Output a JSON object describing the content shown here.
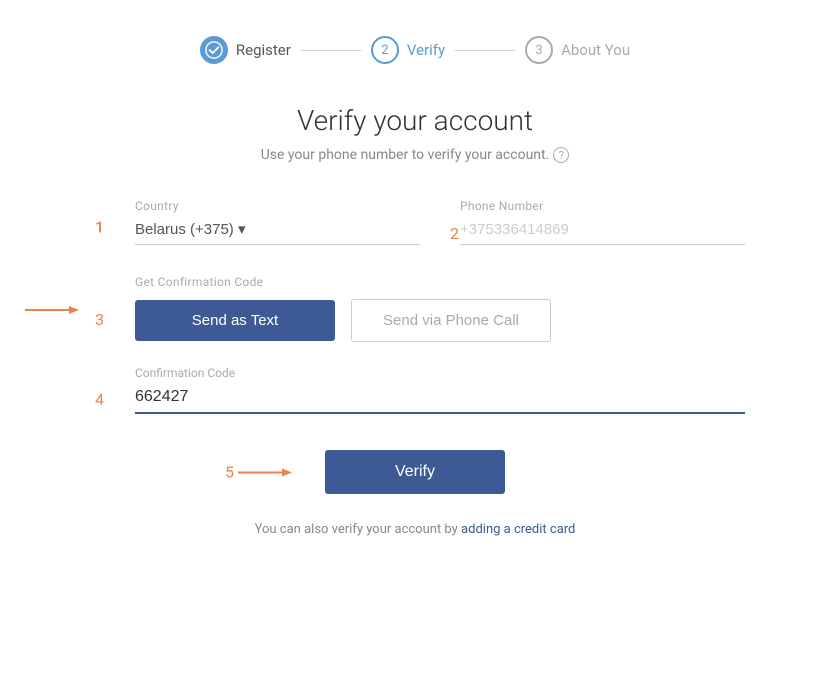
{
  "stepper": {
    "steps": [
      {
        "id": "register",
        "number": "✓",
        "label": "Register",
        "state": "completed"
      },
      {
        "id": "verify",
        "number": "2",
        "label": "Verify",
        "state": "active"
      },
      {
        "id": "about",
        "number": "3",
        "label": "About You",
        "state": "inactive"
      }
    ]
  },
  "page": {
    "title": "Verify your account",
    "subtitle": "Use your phone number to verify your account."
  },
  "form": {
    "country_label": "Country",
    "country_placeholder": "Belarus (+375) ▾",
    "phone_label": "Phone Number",
    "phone_placeholder": "+375336414869",
    "get_code_label": "Get Confirmation Code",
    "send_text_label": "Send as Text",
    "send_phone_label": "Send via Phone Call",
    "confirm_label": "Confirmation Code",
    "confirm_value": "662427",
    "verify_label": "Verify"
  },
  "footer": {
    "text": "You can also verify your account by",
    "link_text": "adding a credit card"
  },
  "step_numbers": {
    "s1": "1",
    "s2": "2",
    "s3": "3",
    "s4": "4",
    "s5": "5"
  }
}
